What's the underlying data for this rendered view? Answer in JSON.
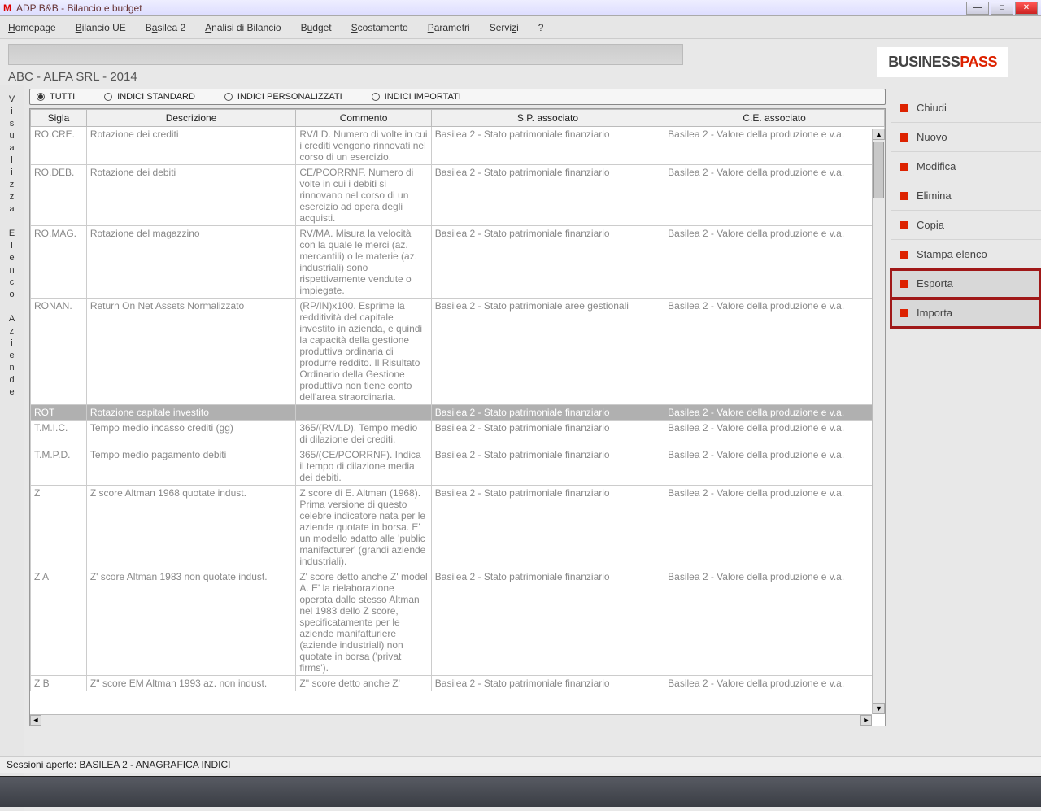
{
  "titlebar": {
    "title": "ADP B&B - Bilancio e budget"
  },
  "menu": {
    "items": [
      "Homepage",
      "Bilancio UE",
      "Basilea 2",
      "Analisi di Bilancio",
      "Budget",
      "Scostamento",
      "Parametri",
      "Servizi",
      "?"
    ]
  },
  "context_label": "ABC - ALFA SRL - 2014",
  "logo": {
    "part1": "BUSINESS",
    "part2": "PASS"
  },
  "left_tabs": {
    "a": "Visualizza",
    "b": "Elenco",
    "c": "Aziende"
  },
  "radios": {
    "all": "TUTTI",
    "std": "INDICI STANDARD",
    "pers": "INDICI PERSONALIZZATI",
    "imp": "INDICI IMPORTATI"
  },
  "table": {
    "headers": {
      "sigla": "Sigla",
      "descrizione": "Descrizione",
      "commento": "Commento",
      "sp": "S.P. associato",
      "ce": "C.E. associato"
    },
    "rows": [
      {
        "sigla": "RO.CRE.",
        "descr": "Rotazione dei crediti",
        "comm": "RV/LD. Numero di volte in cui i crediti vengono rinnovati nel corso di un esercizio.",
        "sp": "Basilea 2 - Stato patrimoniale finanziario",
        "ce": "Basilea 2 - Valore della produzione e v.a.",
        "sel": false
      },
      {
        "sigla": "RO.DEB.",
        "descr": "Rotazione dei debiti",
        "comm": "CE/PCORRNF. Numero di volte in cui i debiti si rinnovano nel corso di un esercizio ad opera degli acquisti.",
        "sp": "Basilea 2 - Stato patrimoniale finanziario",
        "ce": "Basilea 2 - Valore della produzione e v.a.",
        "sel": false
      },
      {
        "sigla": "RO.MAG.",
        "descr": "Rotazione del magazzino",
        "comm": "RV/MA. Misura la velocità con la quale le merci (az. mercantili) o le materie (az. industriali) sono rispettivamente vendute o impiegate.",
        "sp": "Basilea 2 - Stato patrimoniale finanziario",
        "ce": "Basilea 2 - Valore della produzione e v.a.",
        "sel": false
      },
      {
        "sigla": "RONAN.",
        "descr": "Return On Net Assets Normalizzato",
        "comm": "(RP/IN)x100. Esprime la redditività del capitale investito in azienda, e quindi la capacità della gestione produttiva ordinaria di produrre reddito. Il Risultato Ordinario della Gestione produttiva non tiene conto dell'area straordinaria.",
        "sp": "Basilea 2 - Stato patrimoniale aree gestionali",
        "ce": "Basilea 2 - Valore della produzione e v.a.",
        "sel": false
      },
      {
        "sigla": "ROT",
        "descr": "Rotazione capitale investito",
        "comm": "",
        "sp": "Basilea 2 - Stato patrimoniale finanziario",
        "ce": "Basilea 2 - Valore della produzione e v.a.",
        "sel": true
      },
      {
        "sigla": "T.M.I.C.",
        "descr": "Tempo medio incasso crediti (gg)",
        "comm": "365/(RV/LD). Tempo medio di dilazione dei crediti.",
        "sp": "Basilea 2 - Stato patrimoniale finanziario",
        "ce": "Basilea 2 - Valore della produzione e v.a.",
        "sel": false
      },
      {
        "sigla": "T.M.P.D.",
        "descr": "Tempo medio pagamento debiti",
        "comm": "365/(CE/PCORRNF). Indica il tempo di dilazione media dei debiti.",
        "sp": "Basilea 2 - Stato patrimoniale finanziario",
        "ce": "Basilea 2 - Valore della produzione e v.a.",
        "sel": false
      },
      {
        "sigla": "Z",
        "descr": "Z score  Altman 1968 quotate indust.",
        "comm": "Z score di E. Altman (1968). Prima versione di questo celebre indicatore nata per le aziende quotate in borsa. E' un modello adatto alle 'public manifacturer' (grandi aziende industriali).",
        "sp": "Basilea 2 - Stato patrimoniale finanziario",
        "ce": "Basilea 2 - Valore della produzione e v.a.",
        "sel": false
      },
      {
        "sigla": "Z A",
        "descr": "Z' score Altman 1983 non quotate indust.",
        "comm": "Z' score detto anche Z' model A. E' la rielaborazione operata dallo stesso Altman nel 1983 dello Z score, specificatamente per  le aziende manifatturiere (aziende industriali) non quotate in borsa ('privat firms').",
        "sp": "Basilea 2 - Stato patrimoniale finanziario",
        "ce": "Basilea 2 - Valore della produzione e v.a.",
        "sel": false
      },
      {
        "sigla": "Z B",
        "descr": "Z'' score EM Altman 1993 az. non indust.",
        "comm": "Z'' score detto anche Z'",
        "sp": "Basilea 2 - Stato patrimoniale finanziario",
        "ce": "Basilea 2 - Valore della produzione e v.a.",
        "sel": false
      }
    ]
  },
  "actions": [
    {
      "label": "Chiudi",
      "hl": false
    },
    {
      "label": "Nuovo",
      "hl": false
    },
    {
      "label": "Modifica",
      "hl": false
    },
    {
      "label": "Elimina",
      "hl": false
    },
    {
      "label": "Copia",
      "hl": false
    },
    {
      "label": "Stampa elenco",
      "hl": false
    },
    {
      "label": "Esporta",
      "hl": true
    },
    {
      "label": "Importa",
      "hl": true
    }
  ],
  "statusbar": "Sessioni aperte:  BASILEA 2 - ANAGRAFICA INDICI"
}
